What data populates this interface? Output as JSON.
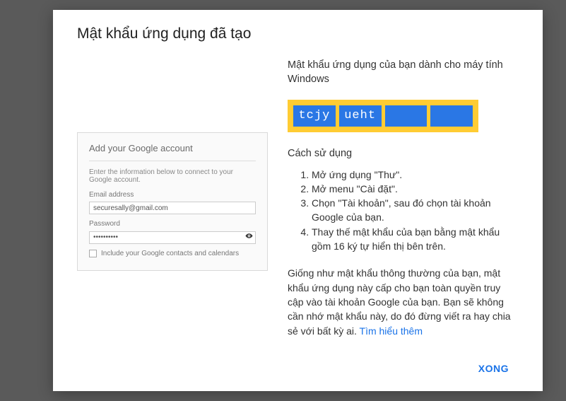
{
  "modal": {
    "title": "Mật khẩu ứng dụng đã tạo",
    "heading_right": "Mật khẩu ứng dụng của bạn dành cho máy tính Windows",
    "password_segments": [
      "tcjy",
      "ueht",
      "",
      ""
    ],
    "howto_title": "Cách sử dụng",
    "howto_steps": [
      "Mở ứng dụng \"Thư\".",
      "Mở menu \"Cài đặt\".",
      "Chọn \"Tài khoản\", sau đó chọn tài khoản Google của bạn.",
      "Thay thế mật khẩu của bạn bằng mật khẩu gồm 16 ký tự hiển thị bên trên."
    ],
    "note": "Giống như mật khẩu thông thường của bạn, mật khẩu ứng dụng này cấp cho bạn toàn quyền truy cập vào tài khoản Google của bạn. Bạn sẽ không cần nhớ mật khẩu này, do đó đừng viết ra hay chia sẻ với bất kỳ ai.",
    "learn_more": "Tìm hiểu thêm",
    "done_label": "XONG"
  },
  "demo": {
    "title": "Add your Google account",
    "hint": "Enter the information below to connect to your Google account.",
    "email_label": "Email address",
    "email_value": "securesally@gmail.com",
    "password_label": "Password",
    "password_value": "••••••••••",
    "checkbox_label": "Include your Google contacts and calendars"
  }
}
